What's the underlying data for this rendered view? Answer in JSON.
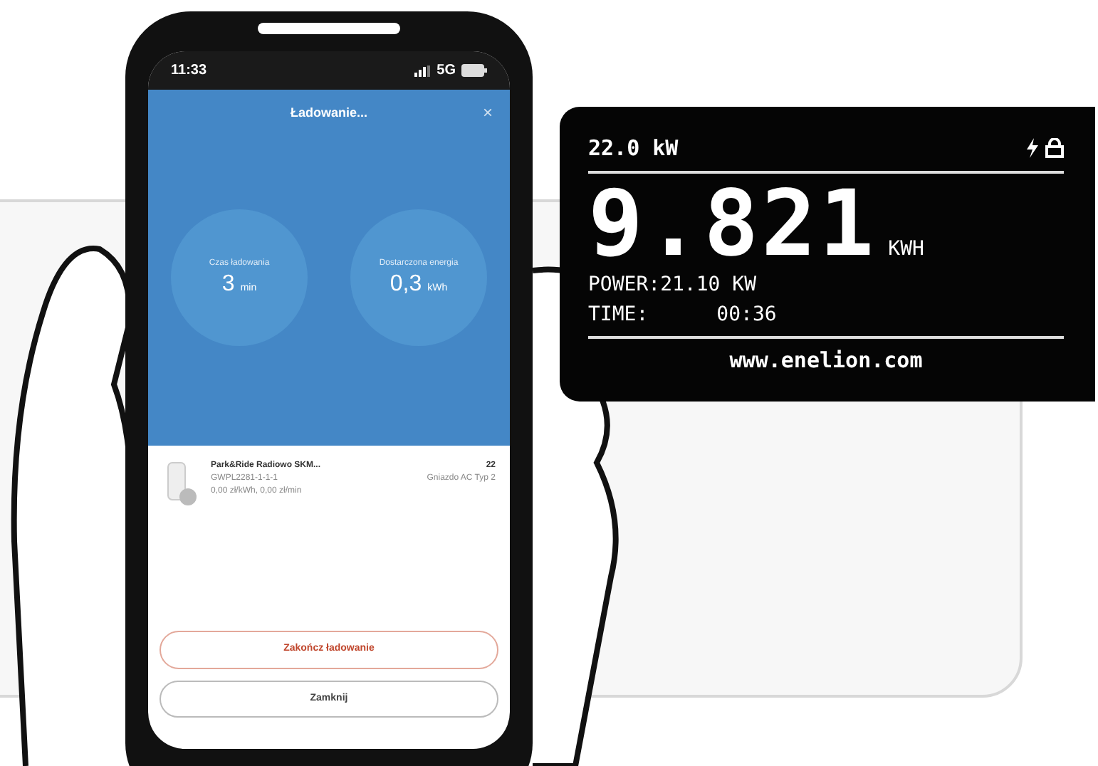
{
  "phone": {
    "status_bar": {
      "time": "11:33",
      "network": "5G"
    },
    "title": "Ładowanie...",
    "close": "×",
    "stats": [
      {
        "label": "Czas ładowania",
        "value": "3",
        "unit": "min"
      },
      {
        "label": "Dostarczona energia",
        "value": "0,3",
        "unit": "kWh"
      }
    ],
    "station": {
      "name": "Park&Ride Radiowo SKM...",
      "code": "GWPL2281-1-1-1",
      "price": "0,00 zł/kWh, 0,00 zł/min",
      "power": "22",
      "connector": "Gniazdo AC Typ 2"
    },
    "buttons": [
      {
        "label": "Zakończ ładowanie",
        "kind": "danger"
      },
      {
        "label": "Zamknij",
        "kind": "plain"
      }
    ]
  },
  "charger_display": {
    "max_power": "22.0 kW",
    "energy": "9.821",
    "energy_unit": "KWH",
    "power": "POWER:21.10 KW",
    "time_label": "TIME:",
    "time": "00:36",
    "website": "www.enelion.com"
  }
}
